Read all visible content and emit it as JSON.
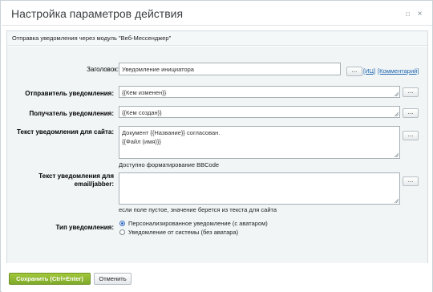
{
  "dialog": {
    "title": "Настройка параметров действия",
    "expand_icon": "□",
    "close_icon": "×"
  },
  "description": "Отправка уведомления через модуль \"Веб-Мессенджер\"",
  "form": {
    "subject": {
      "label": "Заголовок:",
      "value": "Уведомление инициатора",
      "button": "...",
      "links": [
        "[ИЦ]",
        "[Комментарий]"
      ]
    },
    "sender": {
      "label": "Отправитель уведомления:",
      "value": "{{Кем изменен}}",
      "button": "..."
    },
    "recipient": {
      "label": "Получатель уведомления:",
      "value": "{{Кем создан}}",
      "button": "..."
    },
    "site_text": {
      "label": "Текст уведомления для сайта:",
      "lines": [
        "Документ {{Название}} согласован.",
        "",
        "{{Файл (имя)}}"
      ],
      "button": "...",
      "hint": "Доступно форматирование BBCode"
    },
    "email_text": {
      "label_line1": "Текст уведомления для",
      "label_line2": "email/jabber:",
      "value": "",
      "button": "...",
      "hint": "если поле пустое, значение берется из текста для сайта"
    },
    "notification_type": {
      "label": "Тип уведомления:",
      "options": [
        {
          "label": "Персонализированное уведомление (с аватаром)",
          "checked": true
        },
        {
          "label": "Уведомление от системы (без аватара)",
          "checked": false
        }
      ]
    }
  },
  "footer": {
    "save_label": "Сохранить (Ctrl+Enter)",
    "cancel_label": "Отменить"
  },
  "colors": {
    "save_button": "#8db431",
    "link": "#2066b0",
    "form_background": "#f1f5f6"
  }
}
